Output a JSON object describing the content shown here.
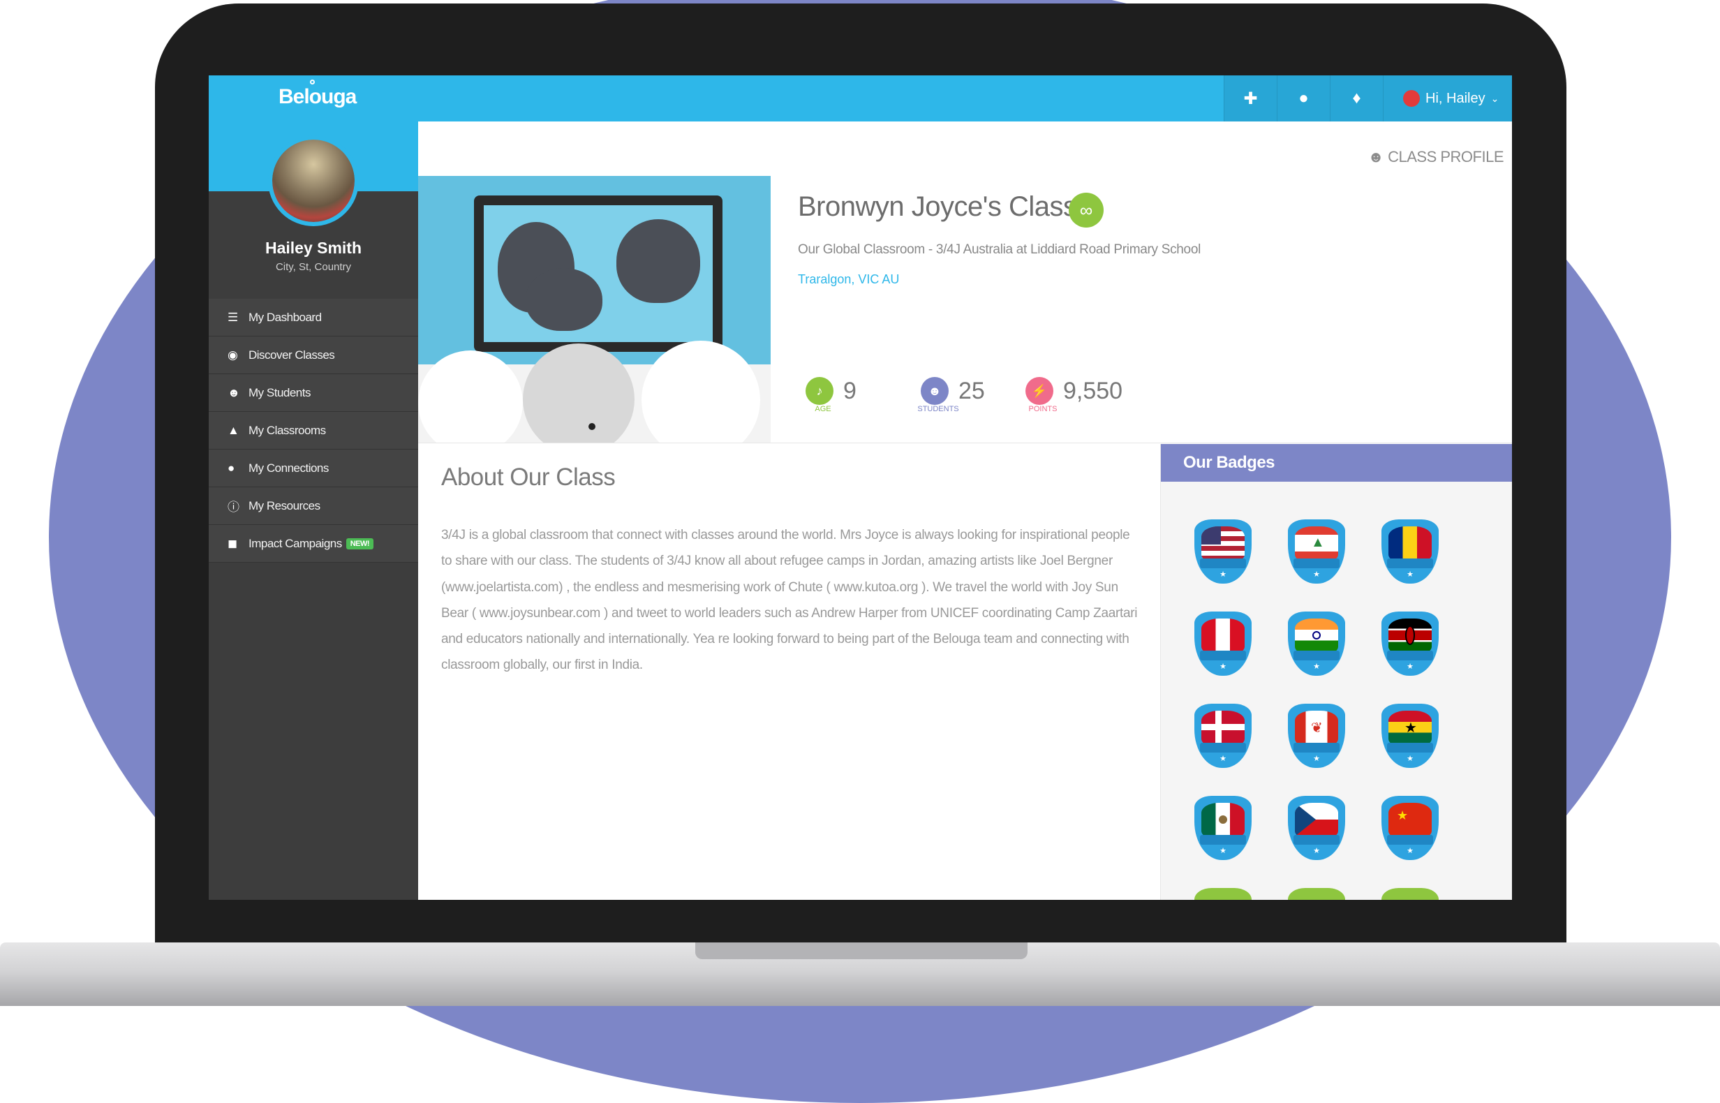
{
  "app": {
    "logo": "Belouga"
  },
  "topbar": {
    "add_friend_icon": "add-user-icon",
    "chat_icon": "chat-icon",
    "bell_icon": "bell-icon",
    "user_greeting": "Hi, Hailey"
  },
  "profile": {
    "name": "Hailey Smith",
    "location": "City, St, Country"
  },
  "sidebar": {
    "items": [
      {
        "label": "My Dashboard",
        "icon": "list-icon"
      },
      {
        "label": "Discover Classes",
        "icon": "binoculars-icon"
      },
      {
        "label": "My Students",
        "icon": "users-icon"
      },
      {
        "label": "My Classrooms",
        "icon": "graduation-cap-icon"
      },
      {
        "label": "My Connections",
        "icon": "chat-bubbles-icon"
      },
      {
        "label": "My Resources",
        "icon": "info-icon"
      },
      {
        "label": "Impact Campaigns",
        "icon": "shield-icon",
        "badge": "NEW!"
      }
    ]
  },
  "page": {
    "header": "CLASS PROFILE"
  },
  "class_info": {
    "title": "Bronwyn Joyce's Class",
    "subtitle": "Our Global Classroom - 3/4J Australia at Liddiard Road Primary School",
    "location": "Traralgon, VIC AU",
    "stats": [
      {
        "label": "AGE",
        "value": "9",
        "color": "#8ec63f"
      },
      {
        "label": "STUDENTS",
        "value": "25",
        "color": "#7d86c7"
      },
      {
        "label": "POINTS",
        "value": "9,550",
        "color": "#f06b8b"
      }
    ]
  },
  "about": {
    "title": "About Our Class",
    "text": "3/4J is a global classroom that connect with classes around the world. Mrs Joyce is always looking for inspirational people to share with our class. The students of 3/4J know all about refugee camps in Jordan, amazing artists like Joel Bergner (www.joelartista.com) , the endless and mesmerising work of Chute ( www.kutoa.org ). We travel the world with Joy Sun Bear ( www.joysunbear.com ) and tweet to world leaders such as Andrew Harper from UNICEF coordinating Camp Zaartari and educators nationally and internationally. Yea re looking forward to being part of the Belouga team and connecting with classroom globally, our first in India."
  },
  "badges": {
    "title": "Our Badges",
    "items": [
      {
        "name": "UNITED STATES"
      },
      {
        "name": "LEBANON"
      },
      {
        "name": "ROMANIA"
      },
      {
        "name": "PERU"
      },
      {
        "name": "INDIA"
      },
      {
        "name": "KENYA"
      },
      {
        "name": "DENMARK"
      },
      {
        "name": "CANADA"
      },
      {
        "name": "GHANA"
      },
      {
        "name": "MEXICO"
      },
      {
        "name": "CZECH REPUBLIC"
      },
      {
        "name": "CHINA"
      }
    ]
  },
  "colors": {
    "primary": "#2eb7e9",
    "sidebar": "#3d3d3d",
    "accent": "#7d86c7",
    "new_badge": "#4cbc55"
  }
}
